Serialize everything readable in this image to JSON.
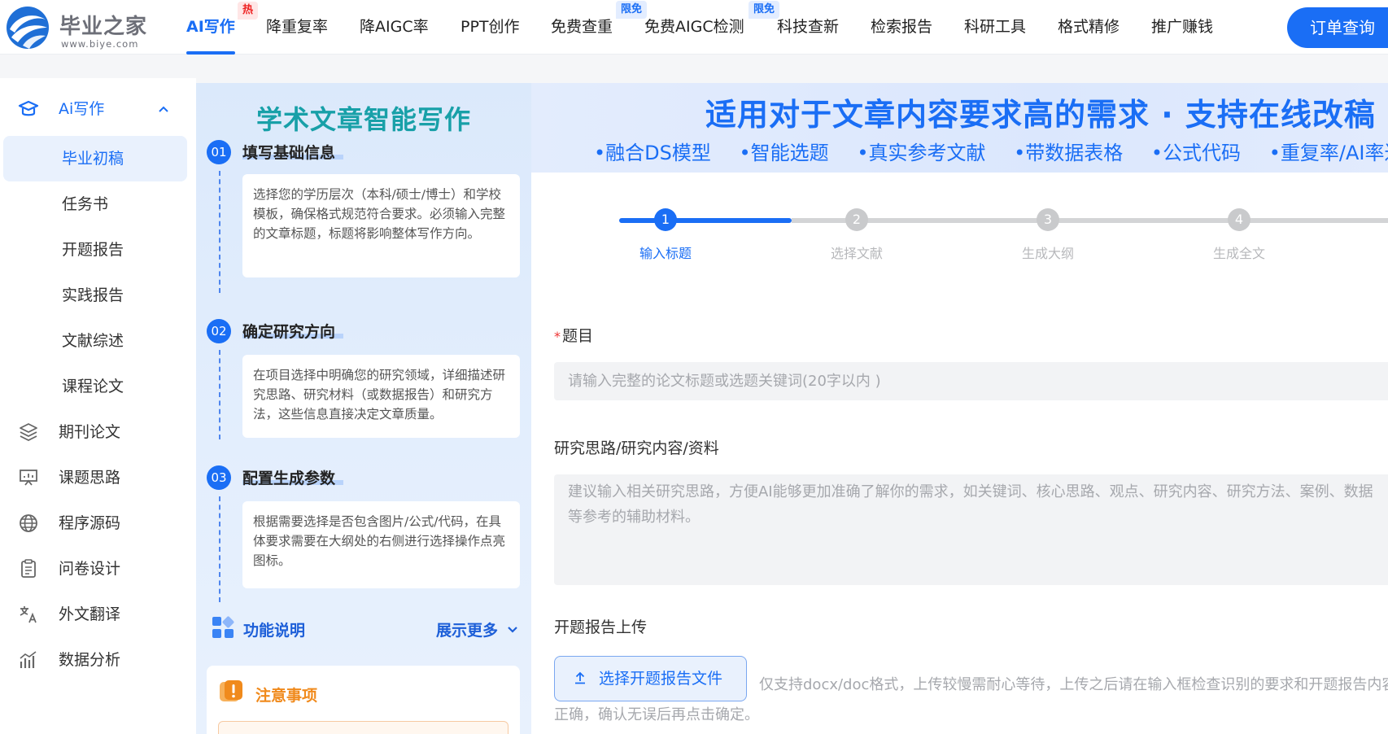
{
  "brand": {
    "name": "毕业之家",
    "url": "www.biye.com"
  },
  "nav": {
    "items": [
      "AI写作",
      "降重复率",
      "降AIGC率",
      "PPT创作",
      "免费查重",
      "免费AIGC检测",
      "科技查新",
      "检索报告",
      "科研工具",
      "格式精修",
      "推广赚钱"
    ],
    "badges": {
      "hot": "热",
      "free1": "限免",
      "free2": "限免"
    },
    "order_label": "订单查询"
  },
  "sidebar": {
    "top_label": "Ai写作",
    "caret": "^",
    "sub_items": [
      "毕业初稿",
      "任务书",
      "开题报告",
      "实践报告",
      "文献综述",
      "课程论文"
    ],
    "items": [
      "期刊论文",
      "课题思路",
      "程序源码",
      "问卷设计",
      "外文翻译",
      "数据分析"
    ]
  },
  "guide": {
    "title": "学术文章智能写作",
    "steps": [
      {
        "num": "01",
        "title": "填写基础信息",
        "desc": "选择您的学历层次（本科/硕士/博士）和学校模板，确保格式规范符合要求。必须输入完整的文章标题，标题将影响整体写作方向。"
      },
      {
        "num": "02",
        "title": "确定研究方向",
        "desc": "在项目选择中明确您的研究领域，详细描述研究思路、研究材料（或数据报告）和研究方法，这些信息直接决定文章质量。"
      },
      {
        "num": "03",
        "title": "配置生成参数",
        "desc": "根据需要选择是否包含图片/公式/代码，在具体要求需要在大纲处的右侧进行选择操作点亮图标。"
      }
    ],
    "func_title": "功能说明",
    "func_more": "展示更多",
    "notice_title": "注意事项"
  },
  "banner": {
    "title": "适用对于文章内容要求高的需求 · 支持在线改稿",
    "features": [
      "•融合DS模型",
      "•智能选题",
      "•真实参考文献",
      "•带数据表格",
      "•公式代码",
      "•重复率/AI率达标"
    ]
  },
  "steps": {
    "current": 1,
    "items": [
      {
        "num": "1",
        "label": "输入标题"
      },
      {
        "num": "2",
        "label": "选择文献"
      },
      {
        "num": "3",
        "label": "生成大纲"
      },
      {
        "num": "4",
        "label": "生成全文"
      }
    ]
  },
  "form": {
    "title_label": "题目",
    "required_mark": "*",
    "title_placeholder": "请输入完整的论文标题或选题关键词(20字以内 )",
    "research_label": "研究思路/研究内容/资料",
    "research_placeholder": "建议输入相关研究思路，方便AI能够更加准确了解你的需求，如关键词、核心思路、观点、研究内容、研究方法、案例、数据等参考的辅助材料。",
    "upload_label": "开题报告上传",
    "upload_button": "选择开题报告文件",
    "upload_hint": "仅支持docx/doc格式，上传较慢需耐心等待，上传之后请在输入框检查识别的要求和开题报告内容是否正确，确认无误后再点击确定。"
  },
  "colors": {
    "accent": "#1a6ef5",
    "teal_title": "#18a0a8",
    "notice_orange": "#f08a1c",
    "hot_red": "#ee2222"
  }
}
